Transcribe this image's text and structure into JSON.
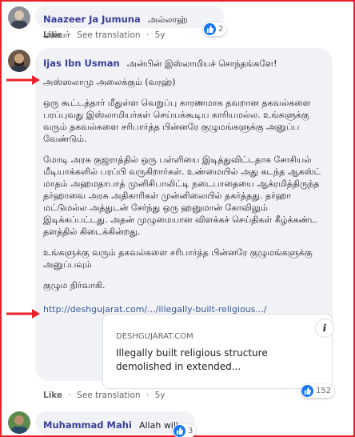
{
  "comments": [
    {
      "author": "Naazeer Ja Jumuna",
      "text": "அல்லாஹ் அக்பர்",
      "like_label": "Like",
      "translate_label": "See translation",
      "age": "5y",
      "reaction_count": "2"
    },
    {
      "author": "Ijas Ibn Usman",
      "intro": "அன்பின் இஸ்லாமியச் சொந்தங்களே!",
      "greeting": "அஸ்ஸலாமு அலைக்கும் (வரஹ்)",
      "para1": "ஒரு கூட்டத்தார் மீதுள்ள வெறுப்பு காரணமாக தவறான தகவல்களை பரப்புவது இஸ்லாமியர்கள் செய்யக்கூடிய காரியமல்ல. உங்களுக்கு வரும் தகவல்களை சரிபார்த்த பின்னரே குழுமங்களுக்கு அனுப்ப வேண்டும்.",
      "para2": "மோடி அரசு குஜராத்தில் ஒரு பள்ளியை இடித்துவிட்டதாக சோசியல் மீடியாக்களில் பரப்பி வருகிறார்கள். உண்மையில் அது கடந்த ஆகஸ்ட் மாதம் அஹமதாபாத் முனிசிபாலிட்டி நடைபாதையை ஆக்ரமித்திருந்த தர்ஹாவை அரசு அதிகாரிகள் முன்னிலையில் தகர்த்தது. தர்ஹா மட்டுமல்ல அத்துடன் சேர்ந்து ஒரு ஹனுமான் கோவிலும் இடிக்கப்பட்டது. அதன் முழுமையான விளக்கச் செய்திகள் கீழ்க்கண்ட தளத்தில் கிடைக்கின்றது.",
      "para3": "உங்களுக்கு வரும் தகவல்களை சரிபார்த்த பின்னரே குழுமங்களுக்கு அனுப்பவும்",
      "para4": "குழும நிர்வாகி.",
      "link": "http://deshgujarat.com/.../illegally-built-religious.../",
      "card_domain": "DESHGUJARAT.COM",
      "card_title": "Illegally built religious structure demolished in extended...",
      "card_info": "i",
      "like_label": "Like",
      "translate_label": "See translation",
      "age": "5y",
      "reaction_count": "152"
    },
    {
      "author": "Muhammad Mahi",
      "text": "Allah will punish",
      "reaction_count": "3"
    }
  ],
  "colors": {
    "annotation_red": "#e8212b",
    "like_blue": "#1877f2",
    "author_blue": "#3b3f9a",
    "bubble_bg": "#f0f2f5"
  }
}
